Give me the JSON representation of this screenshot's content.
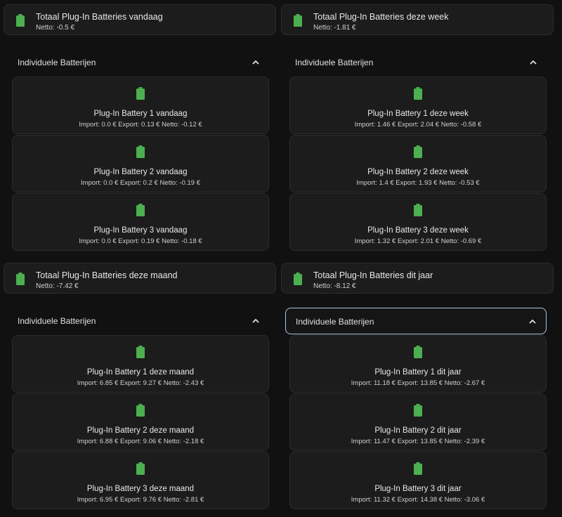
{
  "colors": {
    "battery_green": "#4caf50",
    "background": "#111111",
    "card": "#1c1c1c",
    "focus_outline": "#a9c4ea"
  },
  "icons": {
    "battery": "battery-icon",
    "chevron": "chevron-up-icon"
  },
  "sections": [
    {
      "summary": {
        "title": "Totaal Plug-In Batteries vandaag",
        "subtitle": "Netto: -0.5 €"
      },
      "expander": {
        "title": "Individuele Batterijen",
        "expanded": true
      },
      "batteries": [
        {
          "title": "Plug-In Battery 1 vandaag",
          "subtitle": "Import: 0.0 € Export: 0.13 € Netto: -0.12 €"
        },
        {
          "title": "Plug-In Battery 2 vandaag",
          "subtitle": "Import: 0.0 € Export: 0.2 € Netto: -0.19 €"
        },
        {
          "title": "Plug-In Battery 3 vandaag",
          "subtitle": "Import: 0.0 € Export: 0.19 € Netto: -0.18 €"
        }
      ]
    },
    {
      "summary": {
        "title": "Totaal Plug-In Batteries deze week",
        "subtitle": "Netto: -1.81 €"
      },
      "expander": {
        "title": "Individuele Batterijen",
        "expanded": true
      },
      "batteries": [
        {
          "title": "Plug-In Battery 1 deze week",
          "subtitle": "Import: 1.46 € Export: 2.04 € Netto: -0.58 €"
        },
        {
          "title": "Plug-In Battery 2 deze week",
          "subtitle": "Import: 1.4 € Export: 1.93 € Netto: -0.53 €"
        },
        {
          "title": "Plug-In Battery 3 deze week",
          "subtitle": "Import: 1.32 € Export: 2.01 € Netto: -0.69 €"
        }
      ]
    },
    {
      "summary": {
        "title": "Totaal Plug-In Batteries deze maand",
        "subtitle": "Netto: -7.42 €"
      },
      "expander": {
        "title": "Individuele Batterijen",
        "expanded": true
      },
      "batteries": [
        {
          "title": "Plug-In Battery 1 deze maand",
          "subtitle": "Import: 6.85 € Export: 9.27 € Netto: -2.43 €"
        },
        {
          "title": "Plug-In Battery 2 deze maand",
          "subtitle": "Import: 6.88 € Export: 9.06 € Netto: -2.18 €"
        },
        {
          "title": "Plug-In Battery 3 deze maand",
          "subtitle": "Import: 6.95 € Export: 9.76 € Netto: -2.81 €"
        }
      ]
    },
    {
      "summary": {
        "title": "Totaal Plug-In Batteries dit jaar",
        "subtitle": "Netto: -8.12 €"
      },
      "expander": {
        "title": "Individuele Batterijen",
        "expanded": true,
        "focused": true
      },
      "batteries": [
        {
          "title": "Plug-In Battery 1 dit jaar",
          "subtitle": "Import: 11.18 € Export: 13.85 € Netto: -2.67 €"
        },
        {
          "title": "Plug-In Battery 2 dit jaar",
          "subtitle": "Import: 11.47 € Export: 13.85 € Netto: -2.39 €"
        },
        {
          "title": "Plug-In Battery 3 dit jaar",
          "subtitle": "Import: 11.32 € Export: 14.38 € Netto: -3.06 €"
        }
      ]
    }
  ]
}
